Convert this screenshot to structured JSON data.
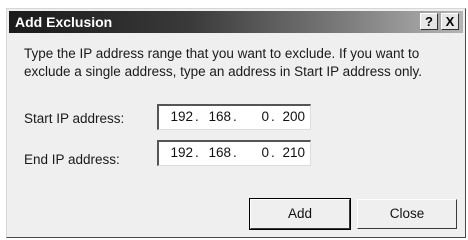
{
  "dialog": {
    "title": "Add Exclusion",
    "help_label": "?",
    "close_label": "X",
    "description": "Type the IP address range that you want to exclude. If you want to exclude a single address, type an address in Start IP address only.",
    "start": {
      "label": "Start IP address:",
      "octets": [
        "192",
        "168",
        "0",
        "200"
      ]
    },
    "end": {
      "label": "End IP address:",
      "octets": [
        "192",
        "168",
        "0",
        "210"
      ]
    },
    "add_label": "Add",
    "cancel_label": "Close"
  }
}
